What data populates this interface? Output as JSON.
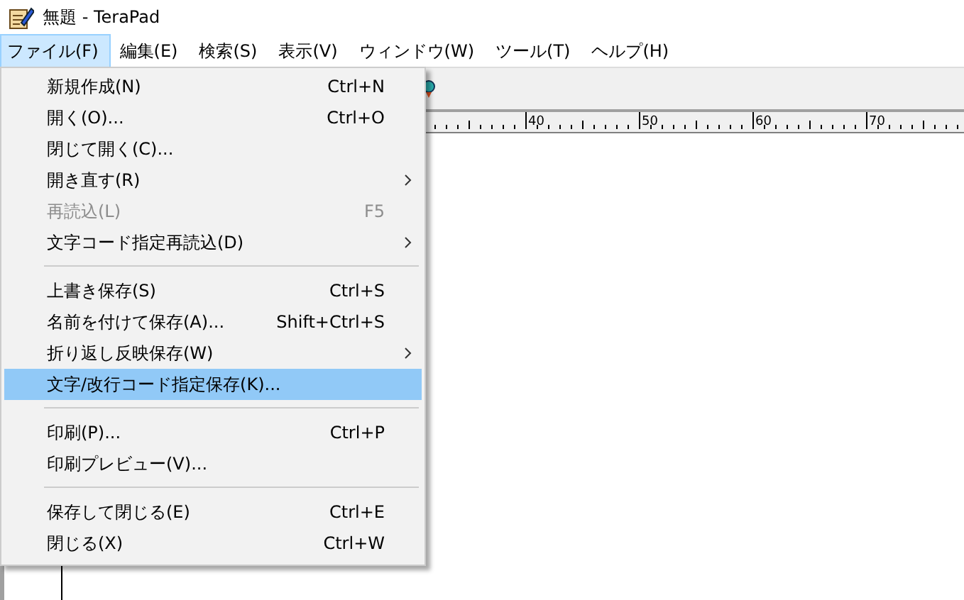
{
  "window": {
    "title": "無題 - TeraPad"
  },
  "menubar": [
    {
      "label": "ファイル(F)",
      "selected": true
    },
    {
      "label": "編集(E)",
      "selected": false
    },
    {
      "label": "検索(S)",
      "selected": false
    },
    {
      "label": "表示(V)",
      "selected": false
    },
    {
      "label": "ウィンドウ(W)",
      "selected": false
    },
    {
      "label": "ツール(T)",
      "selected": false
    },
    {
      "label": "ヘルプ(H)",
      "selected": false
    }
  ],
  "ruler": {
    "labels": [
      "40",
      "50",
      "60",
      "70"
    ]
  },
  "file_menu": [
    {
      "kind": "item",
      "label": "新規作成(N)",
      "shortcut": "Ctrl+N",
      "submenu": false,
      "disabled": false,
      "selected": false
    },
    {
      "kind": "item",
      "label": "開く(O)...",
      "shortcut": "Ctrl+O",
      "submenu": false,
      "disabled": false,
      "selected": false
    },
    {
      "kind": "item",
      "label": "閉じて開く(C)...",
      "submenu": false,
      "disabled": false,
      "selected": false
    },
    {
      "kind": "item",
      "label": "開き直す(R)",
      "submenu": true,
      "disabled": false,
      "selected": false
    },
    {
      "kind": "item",
      "label": "再読込(L)",
      "shortcut": "F5",
      "submenu": false,
      "disabled": true,
      "selected": false
    },
    {
      "kind": "item",
      "label": "文字コード指定再読込(D)",
      "submenu": true,
      "disabled": false,
      "selected": false
    },
    {
      "kind": "separator"
    },
    {
      "kind": "item",
      "label": "上書き保存(S)",
      "shortcut": "Ctrl+S",
      "submenu": false,
      "disabled": false,
      "selected": false
    },
    {
      "kind": "item",
      "label": "名前を付けて保存(A)...",
      "shortcut": "Shift+Ctrl+S",
      "submenu": false,
      "disabled": false,
      "selected": false
    },
    {
      "kind": "item",
      "label": "折り返し反映保存(W)",
      "submenu": true,
      "disabled": false,
      "selected": false
    },
    {
      "kind": "item",
      "label": "文字/改行コード指定保存(K)...",
      "submenu": false,
      "disabled": false,
      "selected": true
    },
    {
      "kind": "separator"
    },
    {
      "kind": "item",
      "label": "印刷(P)...",
      "shortcut": "Ctrl+P",
      "submenu": false,
      "disabled": false,
      "selected": false
    },
    {
      "kind": "item",
      "label": "印刷プレビュー(V)...",
      "submenu": false,
      "disabled": false,
      "selected": false
    },
    {
      "kind": "separator"
    },
    {
      "kind": "item",
      "label": "保存して閉じる(E)",
      "shortcut": "Ctrl+E",
      "submenu": false,
      "disabled": false,
      "selected": false
    },
    {
      "kind": "item",
      "label": "閉じる(X)",
      "shortcut": "Ctrl+W",
      "submenu": false,
      "disabled": false,
      "selected": false
    }
  ]
}
